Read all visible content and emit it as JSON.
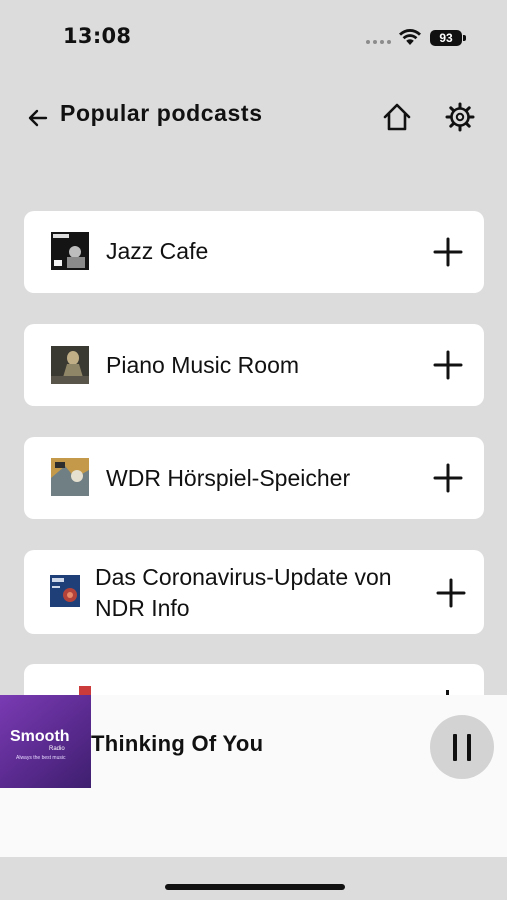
{
  "status": {
    "time": "13:08",
    "battery": "93"
  },
  "header": {
    "title": "Popular podcasts"
  },
  "podcasts": [
    {
      "title": "Jazz Cafe",
      "thumb_icon": "jazz-cafe-art"
    },
    {
      "title": "Piano Music Room",
      "thumb_icon": "piano-music-room-art"
    },
    {
      "title": "WDR Hörspiel-Speicher",
      "thumb_icon": "wdr-hoerspiel-art"
    },
    {
      "title_line1": "Das Coronavirus-Update von",
      "title_line2": "NDR Info",
      "thumb_icon": "ndr-coronavirus-art"
    }
  ],
  "player": {
    "track_title": "Thinking Of You",
    "art_text": "Smooth",
    "art_subtext": "Radio",
    "art_tagline": "Always the best music",
    "accent": "#6b34a6"
  }
}
